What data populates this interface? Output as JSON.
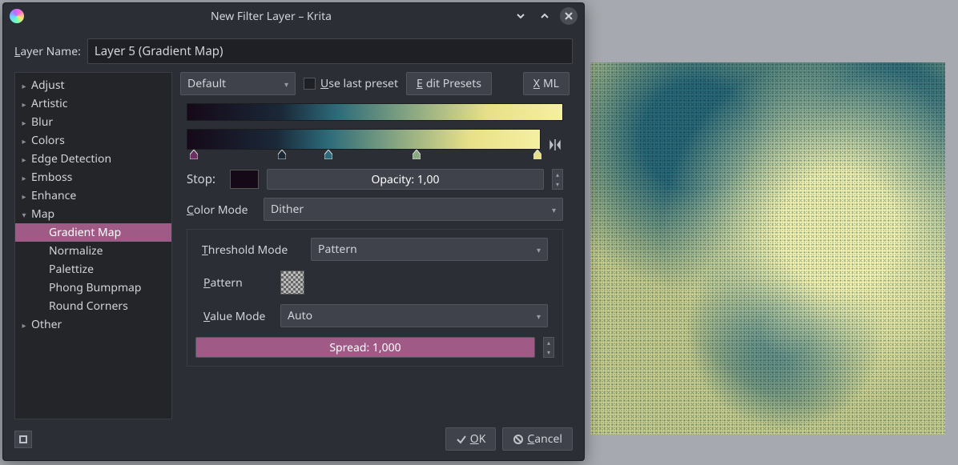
{
  "window": {
    "title": "New Filter Layer – Krita"
  },
  "layer_name_label_pre": "L",
  "layer_name_label_post": "ayer Name:",
  "layer_name_value": "Layer 5 (Gradient Map)",
  "tree": {
    "items": [
      {
        "label": "Adjust",
        "expandable": true,
        "open": false
      },
      {
        "label": "Artistic",
        "expandable": true,
        "open": false
      },
      {
        "label": "Blur",
        "expandable": true,
        "open": false
      },
      {
        "label": "Colors",
        "expandable": true,
        "open": false
      },
      {
        "label": "Edge Detection",
        "expandable": true,
        "open": false
      },
      {
        "label": "Emboss",
        "expandable": true,
        "open": false
      },
      {
        "label": "Enhance",
        "expandable": true,
        "open": false
      },
      {
        "label": "Map",
        "expandable": true,
        "open": true
      },
      {
        "label": "Gradient Map",
        "child": true,
        "selected": true
      },
      {
        "label": "Normalize",
        "child": true
      },
      {
        "label": "Palettize",
        "child": true
      },
      {
        "label": "Phong Bumpmap",
        "child": true
      },
      {
        "label": "Round Corners",
        "child": true
      },
      {
        "label": "Other",
        "expandable": true,
        "open": false
      }
    ]
  },
  "preset": {
    "value": "Default",
    "use_last_pre": "U",
    "use_last_post": "se last preset",
    "edit_pre": "E",
    "edit_post": "dit Presets",
    "xml_pre": "X",
    "xml_post": "ML"
  },
  "stop": {
    "label": "Stop:",
    "color": "#150918",
    "opacity_label": "Opacity: 1,00",
    "opacity_fill_pct": "100%"
  },
  "stops": [
    {
      "pos": "2%",
      "color": "#6e2f62"
    },
    {
      "pos": "27%",
      "color": "#1a2838"
    },
    {
      "pos": "40%",
      "color": "#2d6b7a"
    },
    {
      "pos": "65%",
      "color": "#8aa882"
    },
    {
      "pos": "99%",
      "color": "#e8e088"
    }
  ],
  "color_mode": {
    "label_pre": "C",
    "label_post": "olor Mode",
    "value": "Dither"
  },
  "threshold": {
    "label_pre": "T",
    "label_post": "hreshold Mode",
    "value": "Pattern"
  },
  "pattern": {
    "label_pre": "P",
    "label_post": "attern"
  },
  "value_mode": {
    "label_pre": "V",
    "label_post": "alue Mode",
    "value": "Auto"
  },
  "spread": {
    "label": "Spread:  1,000",
    "fill_pct": "100%"
  },
  "buttons": {
    "ok_pre": "O",
    "ok_post": "K",
    "cancel_pre": "C",
    "cancel_post": "ancel"
  }
}
